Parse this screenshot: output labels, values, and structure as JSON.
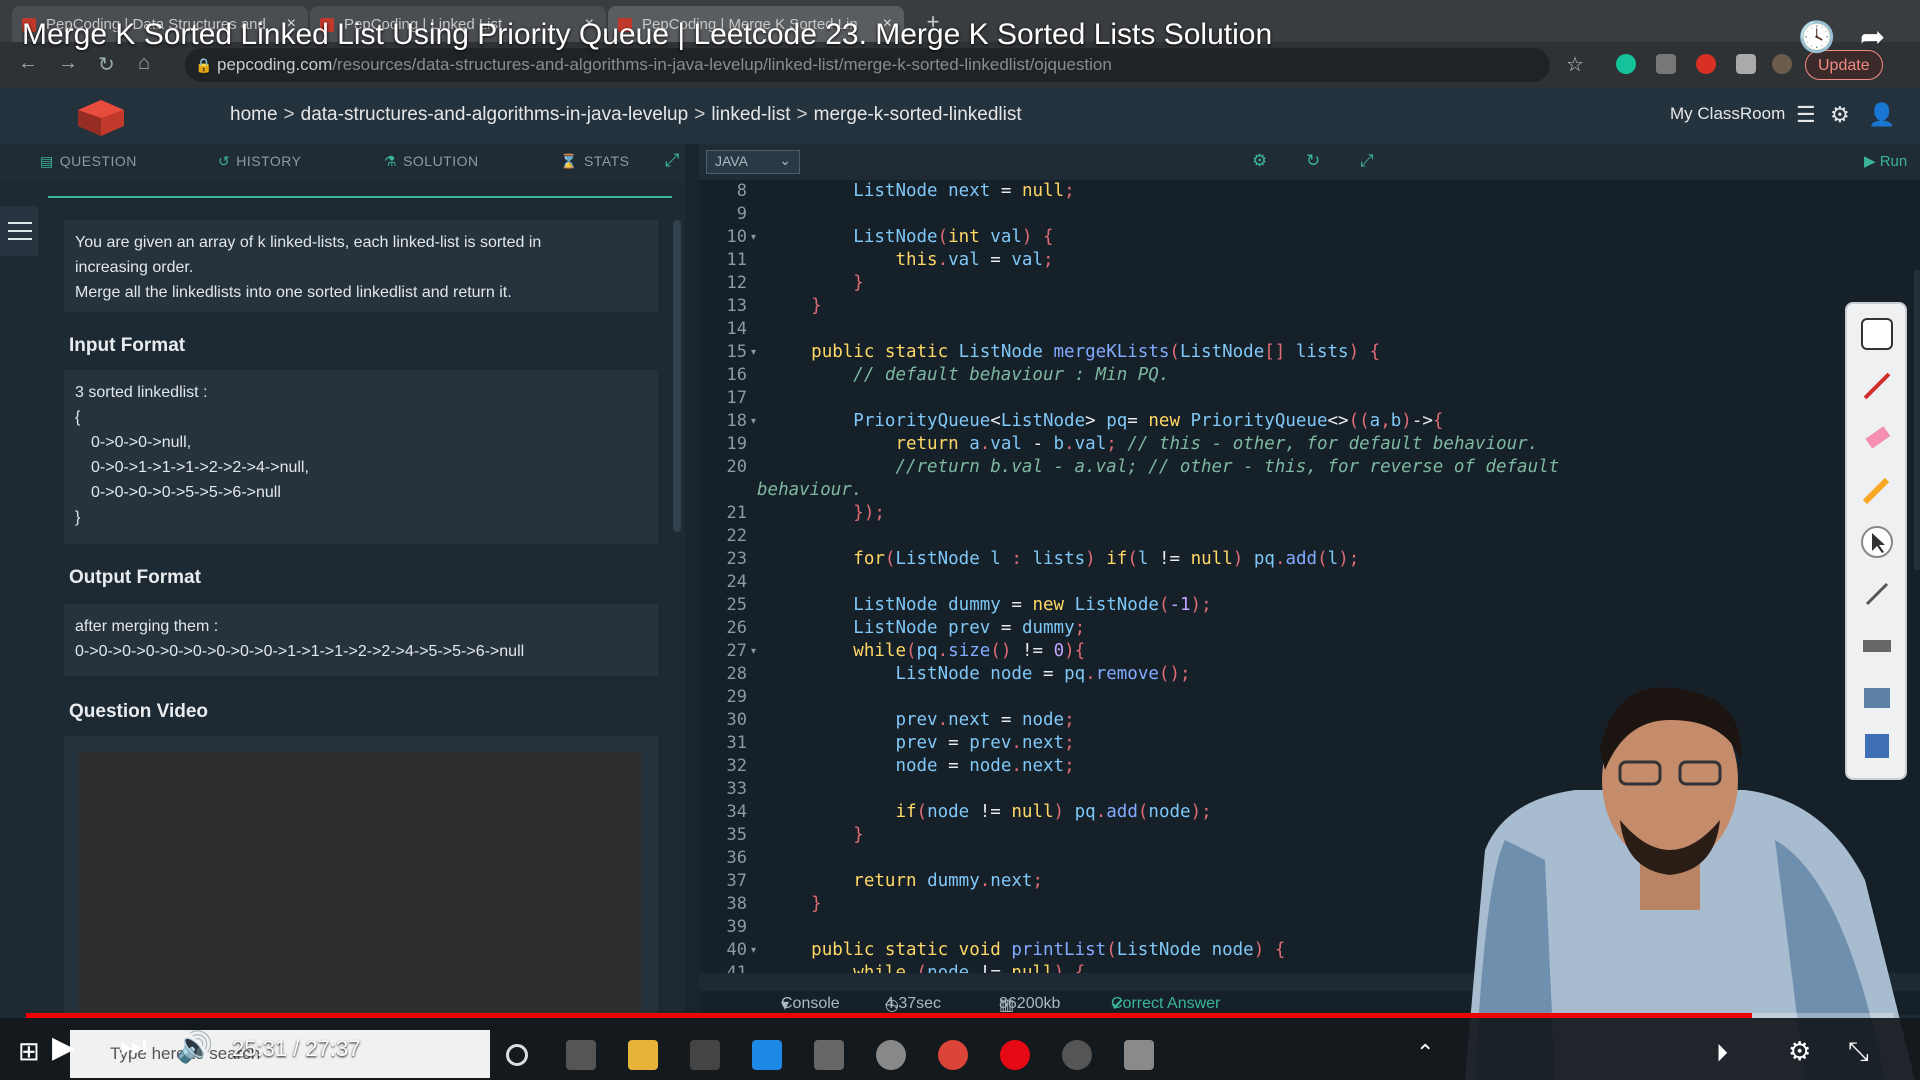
{
  "video": {
    "title": "Merge K Sorted Linked List Using Priority Queue | Leetcode 23. Merge K Sorted Lists Solution",
    "time": "25:31 / 27:37",
    "progress": 0.924
  },
  "browser": {
    "tabs": [
      {
        "label": "PepCoding | Data Structures and"
      },
      {
        "label": "PepCoding | Linked List"
      },
      {
        "label": "PepCoding | Merge K Sorted Lin"
      }
    ],
    "url_host": "pepcoding.com",
    "url_path": "/resources/data-structures-and-algorithms-in-java-levelup/linked-list/merge-k-sorted-linkedlist/ojquestion",
    "update_label": "Update"
  },
  "header": {
    "breadcrumb": [
      "home",
      "data-structures-and-algorithms-in-java-levelup",
      "linked-list",
      "merge-k-sorted-linkedlist"
    ],
    "myclassroom": "My ClassRoom"
  },
  "tabs": {
    "question": "QUESTION",
    "history": "HISTORY",
    "solution": "SOLUTION",
    "stats": "STATS"
  },
  "editor_toolbar": {
    "language": "JAVA",
    "run": "Run"
  },
  "question": {
    "description": [
      "You are given an array of k linked-lists, each linked-list is sorted in",
      "increasing order.",
      "Merge all the linkedlists into one sorted linkedlist and return it."
    ],
    "input_title": "Input Format",
    "input_lines": [
      "3 sorted linkedlist :",
      "{",
      "   0->0->0->null,",
      "   0->0->1->1->1->2->2->4->null,",
      "   0->0->0->0->5->5->6->null",
      "}"
    ],
    "output_title": "Output Format",
    "output_lines": [
      "after merging them :",
      "0->0->0->0->0->0->0->0->0->1->1->1->2->2->4->5->5->6->null"
    ],
    "video_title": "Question Video"
  },
  "code": {
    "line_numbers": [
      "8",
      "9",
      "10",
      "11",
      "12",
      "13",
      "14",
      "15",
      "16",
      "17",
      "18",
      "19",
      "20",
      "",
      "21",
      "22",
      "23",
      "24",
      "25",
      "26",
      "27",
      "28",
      "29",
      "30",
      "31",
      "32",
      "33",
      "34",
      "35",
      "36",
      "37",
      "38",
      "39",
      "40",
      "41"
    ]
  },
  "console": {
    "label": "Console",
    "time": "4.37sec",
    "memory": "86200kb",
    "status": "Correct Answer"
  },
  "taskbar": {
    "search_placeholder": "Type here to search"
  }
}
